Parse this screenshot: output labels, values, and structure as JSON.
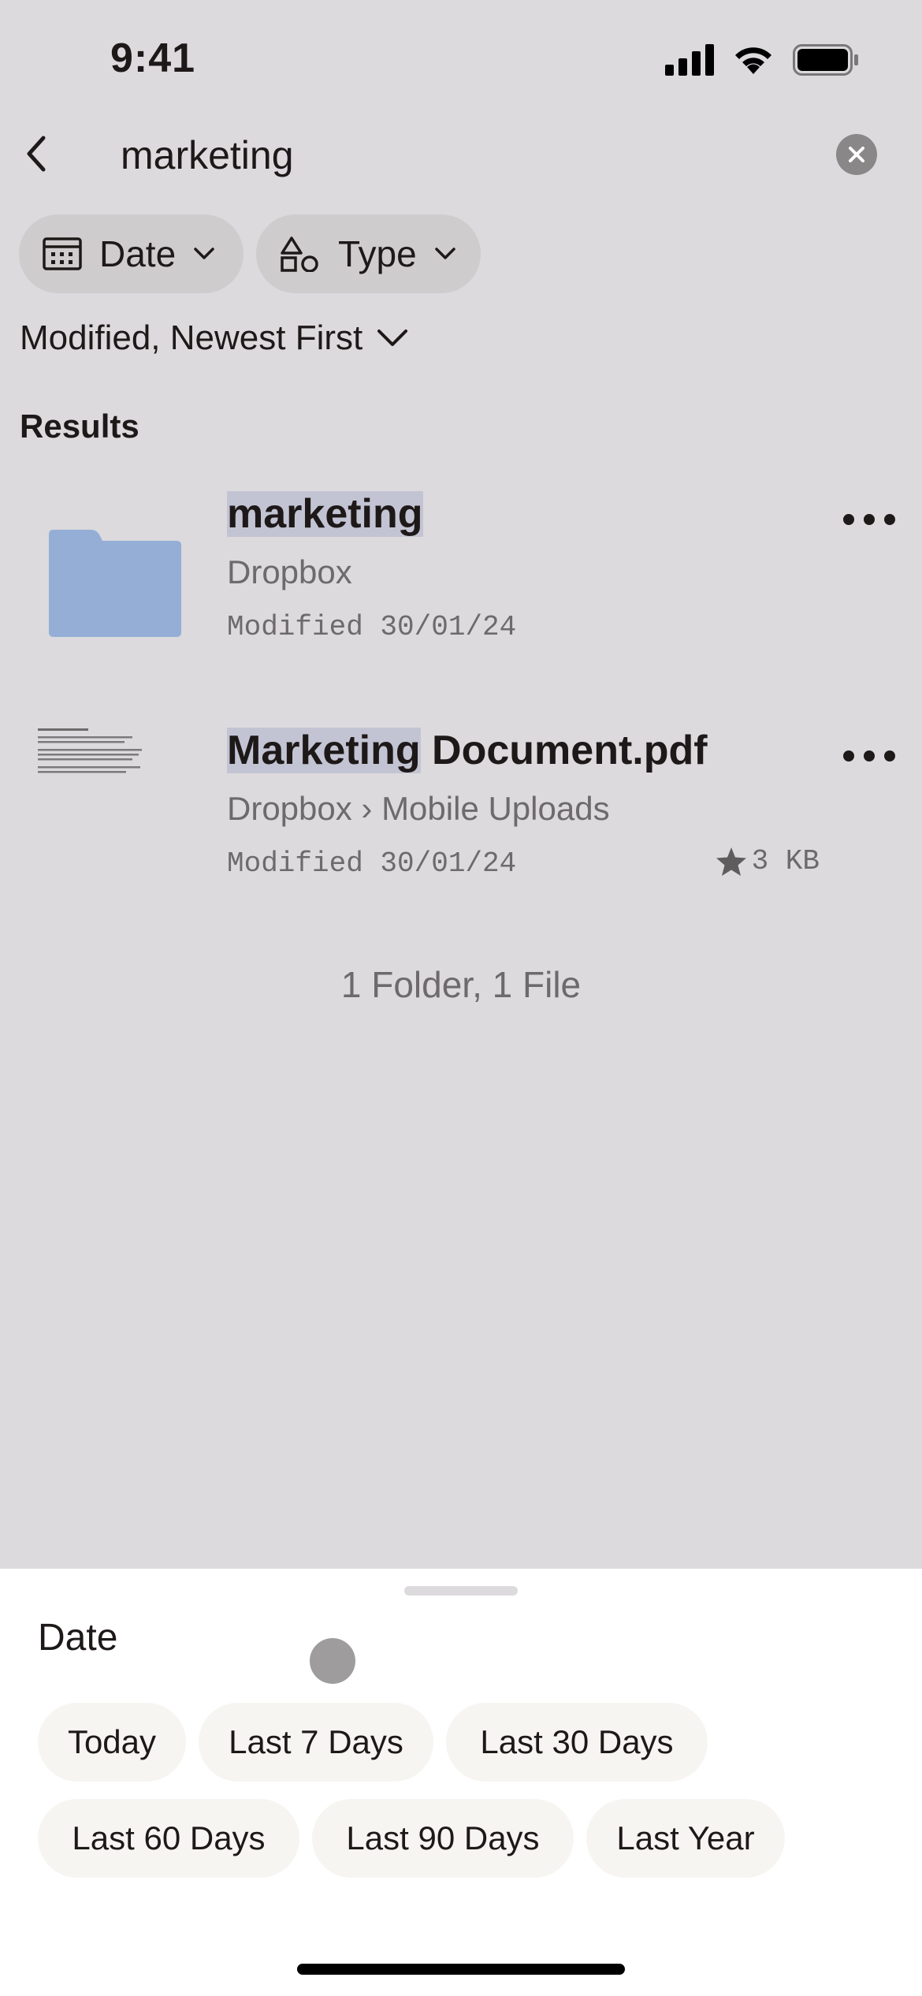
{
  "status": {
    "time": "9:41"
  },
  "search": {
    "query": "marketing"
  },
  "filters": {
    "date_label": "Date",
    "type_label": "Type",
    "sort_label": "Modified, Newest First"
  },
  "results": {
    "heading": "Results",
    "items": [
      {
        "title_highlight": "marketing",
        "title_rest": "",
        "location": "Dropbox",
        "modified": "Modified 30/01/24",
        "thumb": "folder-icon"
      },
      {
        "title_highlight": "Marketing",
        "title_rest": " Document.pdf",
        "location": "Dropbox › Mobile Uploads",
        "modified": "Modified 30/01/24",
        "size": "3 KB",
        "starred": true,
        "thumb": "pdf-thumbnail"
      }
    ],
    "summary": "1 Folder, 1 File"
  },
  "sheet": {
    "title": "Date",
    "options": [
      "Today",
      "Last 7 Days",
      "Last 30 Days",
      "Last 60 Days",
      "Last 90 Days",
      "Last Year"
    ]
  },
  "colors": {
    "background": "#dcdadd",
    "highlight": "#c3c4d3",
    "folder": "#94aed6",
    "chip": "#cfccce"
  }
}
